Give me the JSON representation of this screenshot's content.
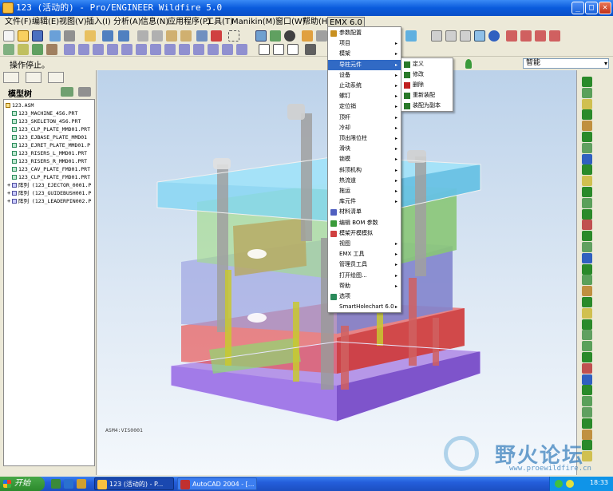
{
  "window": {
    "title": "123 (活动的) - Pro/ENGINEER Wildfire 5.0",
    "buttons": {
      "minimize": "_",
      "maximize": "□",
      "close": "✕"
    }
  },
  "menubar": {
    "items": [
      "文件(F)",
      "编辑(E)",
      "视图(V)",
      "插入(I)",
      "分析(A)",
      "信息(N)",
      "应用程序(P)",
      "工具(T)",
      "Manikin(M)",
      "窗口(W)",
      "帮助(H)",
      "EMX 6.0"
    ]
  },
  "status": {
    "message": "操作停止。",
    "filter_value": "智能",
    "filter_arrow": "▾"
  },
  "left_panel": {
    "title": "模型树",
    "tree": [
      {
        "label": "123.ASM",
        "kind": "asm",
        "expand": ""
      },
      {
        "label": "123_MACHINE_456.PRT",
        "kind": "prt",
        "expand": ""
      },
      {
        "label": "123_SKELETON_456.PRT",
        "kind": "prt",
        "expand": ""
      },
      {
        "label": "123_CLP_PLATE_MMD01.PRT",
        "kind": "prt",
        "expand": ""
      },
      {
        "label": "123_EJBASE_PLATE_MMD01",
        "kind": "prt",
        "expand": ""
      },
      {
        "label": "123_EJRET_PLATE_MMD01.P",
        "kind": "prt",
        "expand": ""
      },
      {
        "label": "123_RISERS_L_MMD01.PRT",
        "kind": "prt",
        "expand": ""
      },
      {
        "label": "123_RISERS_R_MMD01.PRT",
        "kind": "prt",
        "expand": ""
      },
      {
        "label": "123_CAV_PLATE_FMD01.PRT",
        "kind": "prt",
        "expand": ""
      },
      {
        "label": "123_CLP_PLATE_FMD01.PRT",
        "kind": "prt",
        "expand": ""
      },
      {
        "label": "阵列 (123_EJECTOR_0001.P",
        "kind": "arr",
        "expand": "+"
      },
      {
        "label": "阵列 (123_GUIDEBUSH001.P",
        "kind": "arr",
        "expand": "+"
      },
      {
        "label": "阵列 (123_LEADERPIN002.P",
        "kind": "arr",
        "expand": "+"
      }
    ]
  },
  "viewport": {
    "view_label": "ASM4:VIS0001"
  },
  "emx_menu": {
    "items": [
      {
        "label": "参数配置",
        "sub": "",
        "icon": "#c89020"
      },
      {
        "label": "项目",
        "sub": "▸",
        "icon": ""
      },
      {
        "label": "模架",
        "sub": "▸",
        "icon": ""
      },
      {
        "label": "导柱元件",
        "sub": "▸",
        "icon": "",
        "highlight": true
      },
      {
        "label": "设备",
        "sub": "▸",
        "icon": ""
      },
      {
        "label": "止动系统",
        "sub": "▸",
        "icon": ""
      },
      {
        "label": "螺钉",
        "sub": "▸",
        "icon": ""
      },
      {
        "label": "定位销",
        "sub": "▸",
        "icon": ""
      },
      {
        "label": "顶杆",
        "sub": "▸",
        "icon": ""
      },
      {
        "label": "冷却",
        "sub": "▸",
        "icon": ""
      },
      {
        "label": "顶出限位柱",
        "sub": "▸",
        "icon": ""
      },
      {
        "label": "滑块",
        "sub": "▸",
        "icon": ""
      },
      {
        "label": "锁模",
        "sub": "▸",
        "icon": ""
      },
      {
        "label": "斜顶机构",
        "sub": "▸",
        "icon": ""
      },
      {
        "label": "热流道",
        "sub": "▸",
        "icon": ""
      },
      {
        "label": "拖运",
        "sub": "▸",
        "icon": ""
      },
      {
        "label": "库元件",
        "sub": "▸",
        "icon": ""
      },
      {
        "label": "材料清单",
        "sub": "",
        "icon": "#5060c0"
      },
      {
        "label": "编辑 BOM 参数",
        "sub": "",
        "icon": "#3a9a3a"
      },
      {
        "label": "模架开模模拟",
        "sub": "",
        "icon": "#d04040"
      },
      {
        "label": "视图",
        "sub": "▸",
        "icon": ""
      },
      {
        "label": "EMX 工具",
        "sub": "▸",
        "icon": ""
      },
      {
        "label": "管理员工具",
        "sub": "▸",
        "icon": ""
      },
      {
        "label": "打开绘图...",
        "sub": "▸",
        "icon": ""
      },
      {
        "label": "帮助",
        "sub": "▸",
        "icon": ""
      },
      {
        "label": "选项",
        "sub": "",
        "icon": "#2a8a5a"
      },
      {
        "label": "SmartHolechart 6.0",
        "sub": "▸",
        "icon": ""
      }
    ]
  },
  "guide_submenu": {
    "items": [
      {
        "label": "定义",
        "icon": "#2a7a2a"
      },
      {
        "label": "修改",
        "icon": "#2a7a2a"
      },
      {
        "label": "删除",
        "icon": "#c02020"
      },
      {
        "label": "重新装配",
        "icon": "#2a7a2a"
      },
      {
        "label": "装配为副本",
        "icon": "#2a7a2a"
      }
    ]
  },
  "watermark": {
    "title": "野火论坛",
    "url": "www.proewildfire.cn"
  },
  "taskbar": {
    "start_label": "开始",
    "tasks": [
      {
        "label": "123 (活动的) - P...",
        "active": true,
        "icon": "#f8c040"
      },
      {
        "label": "AutoCAD 2004 - [...",
        "active": false,
        "icon": "#c03030"
      }
    ],
    "clock": "18:33"
  },
  "colors": {
    "accent": "#316ac5",
    "titlebar": "#0a5bdc",
    "top_plate": "#7fd6f4",
    "green_plate": "#9edc8a",
    "purple_plate": "#b8b0e8",
    "red_plate": "#e86060",
    "base_plate": "#9a6ee6"
  }
}
